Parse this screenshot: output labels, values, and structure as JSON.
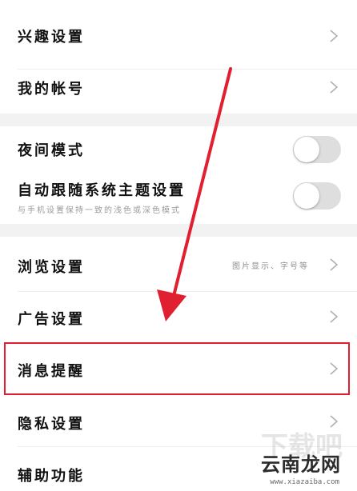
{
  "settings": {
    "interest": "兴趣设置",
    "account": "我的帐号",
    "night_mode": "夜间模式",
    "follow_theme": "自动跟随系统主题设置",
    "follow_theme_desc": "与手机设置保持一致的浅色或深色模式",
    "browse": "浏览设置",
    "browse_hint": "图片显示、字号等",
    "ads": "广告设置",
    "notifications": "消息提醒",
    "privacy": "隐私设置",
    "accessibility": "辅助功能"
  },
  "toggles": {
    "night_mode_on": false,
    "follow_theme_on": false
  },
  "annotation": {
    "highlight_color": "#e02030",
    "arrow_color": "#e02030"
  },
  "watermark": {
    "text": "云南龙网",
    "url": "www.xiazaiba.com",
    "big": "下载吧"
  },
  "colors": {
    "background": "#ffffff",
    "section_gap": "#f2f2f2",
    "toggle_off": "#dedede"
  }
}
